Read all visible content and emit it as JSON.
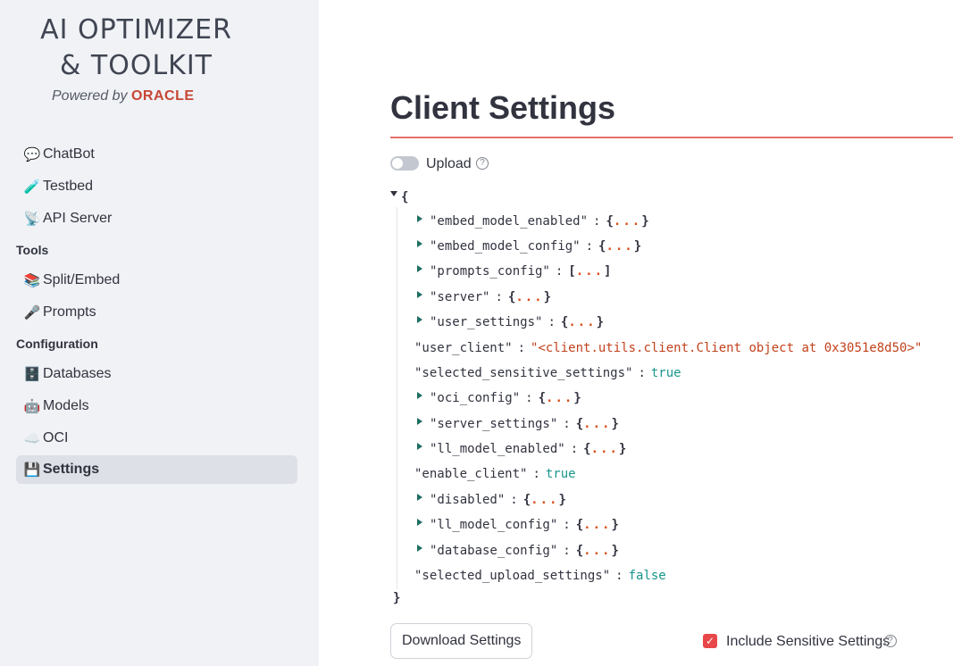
{
  "sidebar": {
    "logo_line1": "AI OPTIMIZER",
    "logo_line2": "& TOOLKIT",
    "powered_prefix": "Powered by",
    "powered_brand": "ORACLE",
    "items": [
      {
        "icon": "💬",
        "label": "ChatBot"
      },
      {
        "icon": "🧪",
        "label": "Testbed"
      },
      {
        "icon": "📡",
        "label": "API Server"
      }
    ],
    "tools_label": "Tools",
    "tools_items": [
      {
        "icon": "📚",
        "label": "Split/Embed"
      },
      {
        "icon": "🎤",
        "label": "Prompts"
      }
    ],
    "config_label": "Configuration",
    "config_items": [
      {
        "icon": "🗄️",
        "label": "Databases"
      },
      {
        "icon": "🤖",
        "label": "Models"
      },
      {
        "icon": "☁️",
        "label": "OCI"
      },
      {
        "icon": "💾",
        "label": "Settings",
        "active": true
      }
    ]
  },
  "main": {
    "title": "Client Settings",
    "upload_label": "Upload",
    "upload_enabled": false,
    "json_tree": {
      "open": "{",
      "close": "}",
      "entries": [
        {
          "key": "\"embed_model_enabled\"",
          "collapsed": "{...}"
        },
        {
          "key": "\"embed_model_config\"",
          "collapsed": "{...}"
        },
        {
          "key": "\"prompts_config\"",
          "collapsed": "[...]"
        },
        {
          "key": "\"server\"",
          "collapsed": "{...}"
        },
        {
          "key": "\"user_settings\"",
          "collapsed": "{...}"
        },
        {
          "key": "\"user_client\"",
          "string": "\"<client.utils.client.Client object at 0x3051e8d50>\""
        },
        {
          "key": "\"selected_sensitive_settings\"",
          "bool": "true"
        },
        {
          "key": "\"oci_config\"",
          "collapsed": "{...}"
        },
        {
          "key": "\"server_settings\"",
          "collapsed": "{...}"
        },
        {
          "key": "\"ll_model_enabled\"",
          "collapsed": "{...}"
        },
        {
          "key": "\"enable_client\"",
          "bool": "true"
        },
        {
          "key": "\"disabled\"",
          "collapsed": "{...}"
        },
        {
          "key": "\"ll_model_config\"",
          "collapsed": "{...}"
        },
        {
          "key": "\"database_config\"",
          "collapsed": "{...}"
        },
        {
          "key": "\"selected_upload_settings\"",
          "bool": "false"
        }
      ]
    },
    "download_button": "Download Settings",
    "include_sensitive_label": "Include Sensitive Settings",
    "include_sensitive_checked": true,
    "help_glyph": "?",
    "check_glyph": "✓"
  },
  "colors": {
    "accent": "#e8474a",
    "oracle": "#c74634",
    "bool": "#17968c",
    "string": "#c2421c"
  }
}
